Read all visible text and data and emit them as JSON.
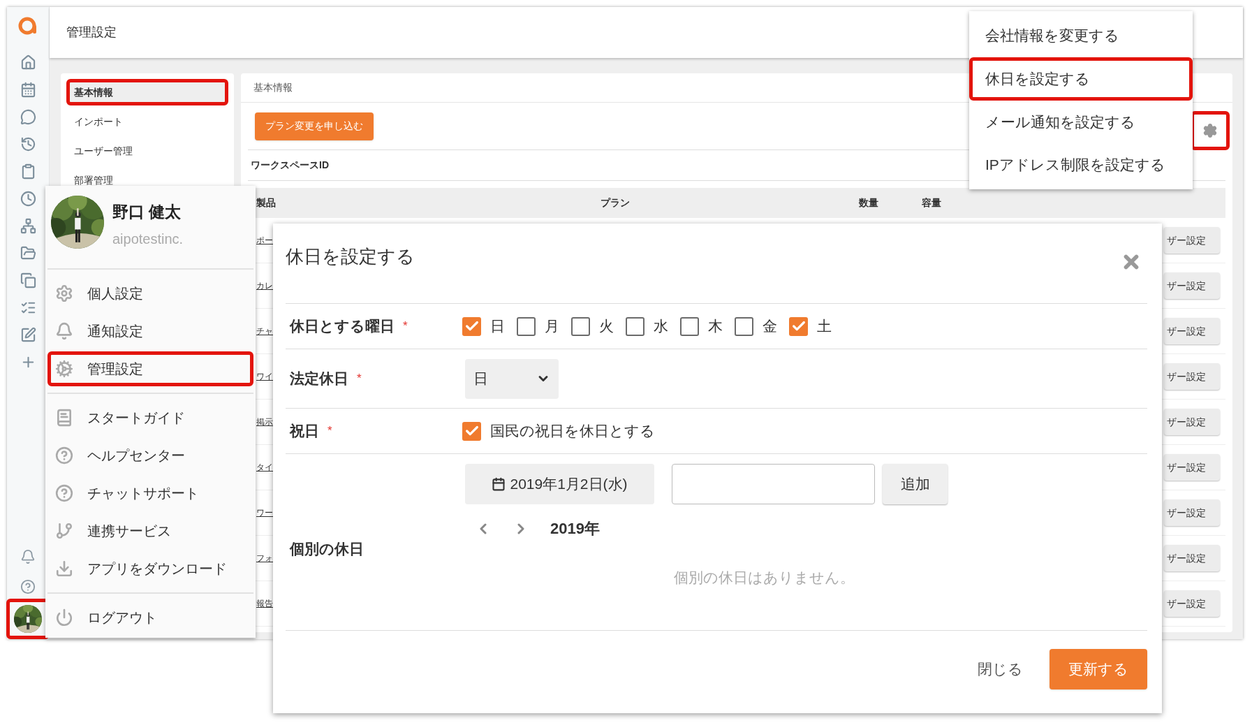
{
  "header": {
    "title": "管理設定"
  },
  "rail": {
    "avatar": {
      "kind": "picture",
      "highlighted": true
    }
  },
  "subnav": {
    "items": [
      {
        "label": "基本情報",
        "selected": true,
        "highlighted": true
      },
      {
        "label": "インポート",
        "selected": false,
        "highlighted": false
      },
      {
        "label": "ユーザー管理",
        "selected": false,
        "highlighted": false
      },
      {
        "label": "部署管理",
        "selected": false,
        "highlighted": false
      }
    ]
  },
  "panel": {
    "title": "基本情報",
    "plan_button": "プラン変更を申し込む",
    "workspace_label": "ワークスペースID",
    "gear_button": {
      "highlighted": true
    },
    "table": {
      "columns": [
        "製品",
        "プラン",
        "数量",
        "容量"
      ],
      "rows": [
        {
          "product": "ポー",
          "action": "ザー設定"
        },
        {
          "product": "カレ",
          "action": "ザー設定"
        },
        {
          "product": "チャ",
          "action": "ザー設定"
        },
        {
          "product": "ワイ",
          "action": "ザー設定"
        },
        {
          "product": "掲示",
          "action": "ザー設定"
        },
        {
          "product": "タイ",
          "action": "ザー設定"
        },
        {
          "product": "ワー",
          "action": "ザー設定"
        },
        {
          "product": "フォ",
          "action": "ザー設定"
        },
        {
          "product": "報告",
          "action": "ザー設定"
        }
      ]
    }
  },
  "settings_menu": {
    "items": [
      {
        "label": "会社情報を変更する",
        "highlighted": false
      },
      {
        "label": "休日を設定する",
        "highlighted": true
      },
      {
        "label": "メール通知を設定する",
        "highlighted": false
      },
      {
        "label": "IPアドレス制限を設定する",
        "highlighted": false
      }
    ]
  },
  "user_menu": {
    "name": "野口 健太",
    "org": "aipotestinc.",
    "avatar": {
      "kind": "picture"
    },
    "groups": [
      [
        {
          "label": "個人設定",
          "kind": "gear",
          "highlighted": false
        },
        {
          "label": "通知設定",
          "kind": "bell",
          "highlighted": false
        },
        {
          "label": "管理設定",
          "kind": "gears",
          "highlighted": true
        }
      ],
      [
        {
          "label": "スタートガイド",
          "kind": "book",
          "highlighted": false
        },
        {
          "label": "ヘルプセンター",
          "kind": "help",
          "highlighted": false
        },
        {
          "label": "チャットサポート",
          "kind": "help-outline",
          "highlighted": false
        },
        {
          "label": "連携サービス",
          "kind": "branch",
          "highlighted": false
        },
        {
          "label": "アプリをダウンロード",
          "kind": "download",
          "highlighted": false
        }
      ],
      [
        {
          "label": "ログアウト",
          "kind": "power",
          "highlighted": false
        }
      ]
    ]
  },
  "dialog": {
    "title": "休日を設定する",
    "weekdays": {
      "label": "休日とする曜日",
      "mark": "*",
      "days": [
        {
          "label": "日",
          "checked": true
        },
        {
          "label": "月",
          "checked": false
        },
        {
          "label": "火",
          "checked": false
        },
        {
          "label": "水",
          "checked": false
        },
        {
          "label": "木",
          "checked": false
        },
        {
          "label": "金",
          "checked": false
        },
        {
          "label": "土",
          "checked": true
        }
      ]
    },
    "legal_holiday": {
      "label": "法定休日",
      "mark": "*",
      "value": "日"
    },
    "national_holidays": {
      "label": "祝日",
      "mark": "*",
      "checked": true,
      "text": "国民の祝日を休日とする"
    },
    "custom": {
      "label": "個別の休日",
      "date": "2019年1月2日(水)",
      "add_button": "追加",
      "year": "2019年",
      "empty_text": "個別の休日はありません。"
    },
    "buttons": {
      "close": "閉じる",
      "submit": "更新する"
    }
  }
}
